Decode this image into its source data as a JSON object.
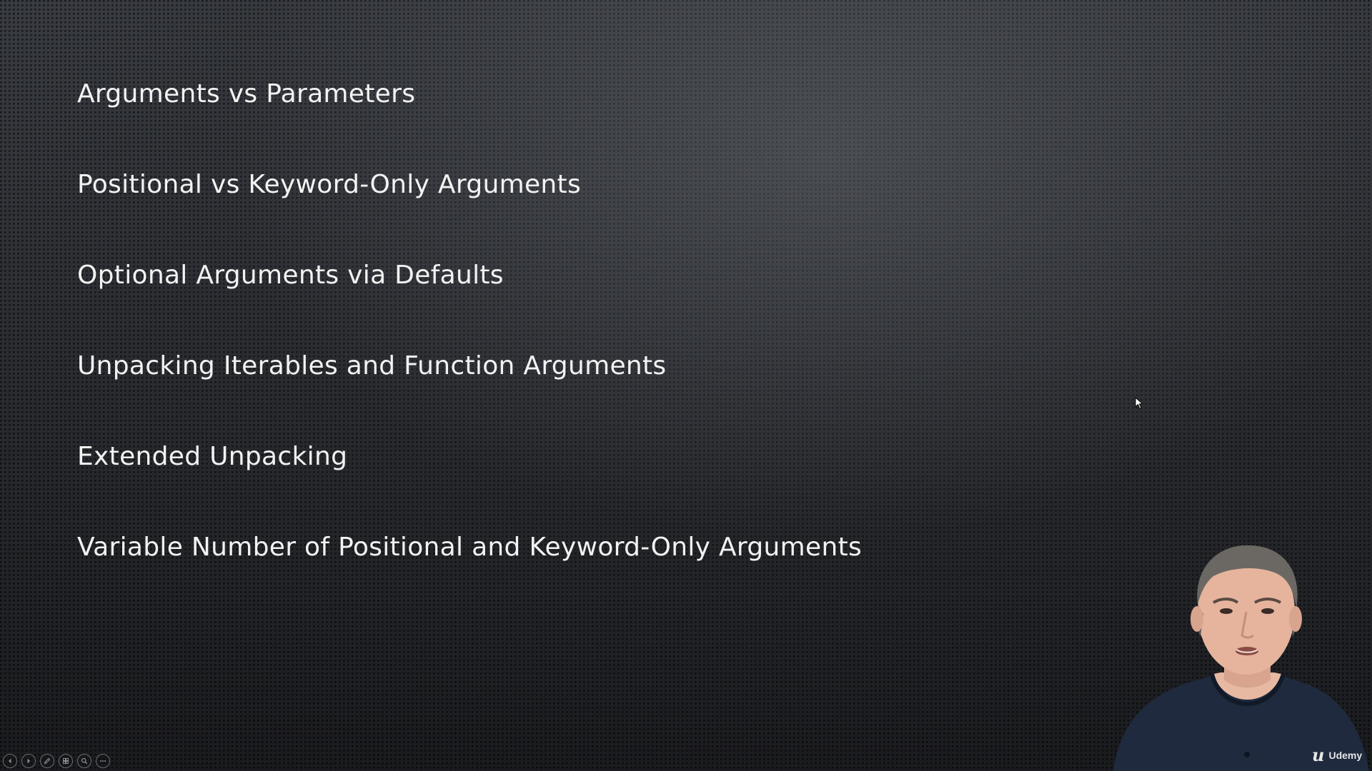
{
  "slide": {
    "topics": [
      "Arguments vs Parameters",
      "Positional vs Keyword-Only Arguments",
      "Optional Arguments via Defaults",
      "Unpacking Iterables and Function Arguments",
      "Extended Unpacking",
      "Variable Number of Positional and Keyword-Only Arguments"
    ]
  },
  "branding": {
    "logo_mark": "u",
    "logo_text": "Udemy"
  },
  "controls": [
    {
      "name": "previous-slide-button",
      "icon": "chevron-left-icon"
    },
    {
      "name": "next-slide-button",
      "icon": "chevron-right-icon"
    },
    {
      "name": "pen-tool-button",
      "icon": "pen-icon"
    },
    {
      "name": "slide-sorter-button",
      "icon": "slides-grid-icon"
    },
    {
      "name": "zoom-button",
      "icon": "magnifier-icon"
    },
    {
      "name": "more-options-button",
      "icon": "more-dots-icon"
    }
  ],
  "colors": {
    "text": "#f2f2f2",
    "background_dark": "#1c1e22",
    "background_light": "#3a3d43"
  }
}
